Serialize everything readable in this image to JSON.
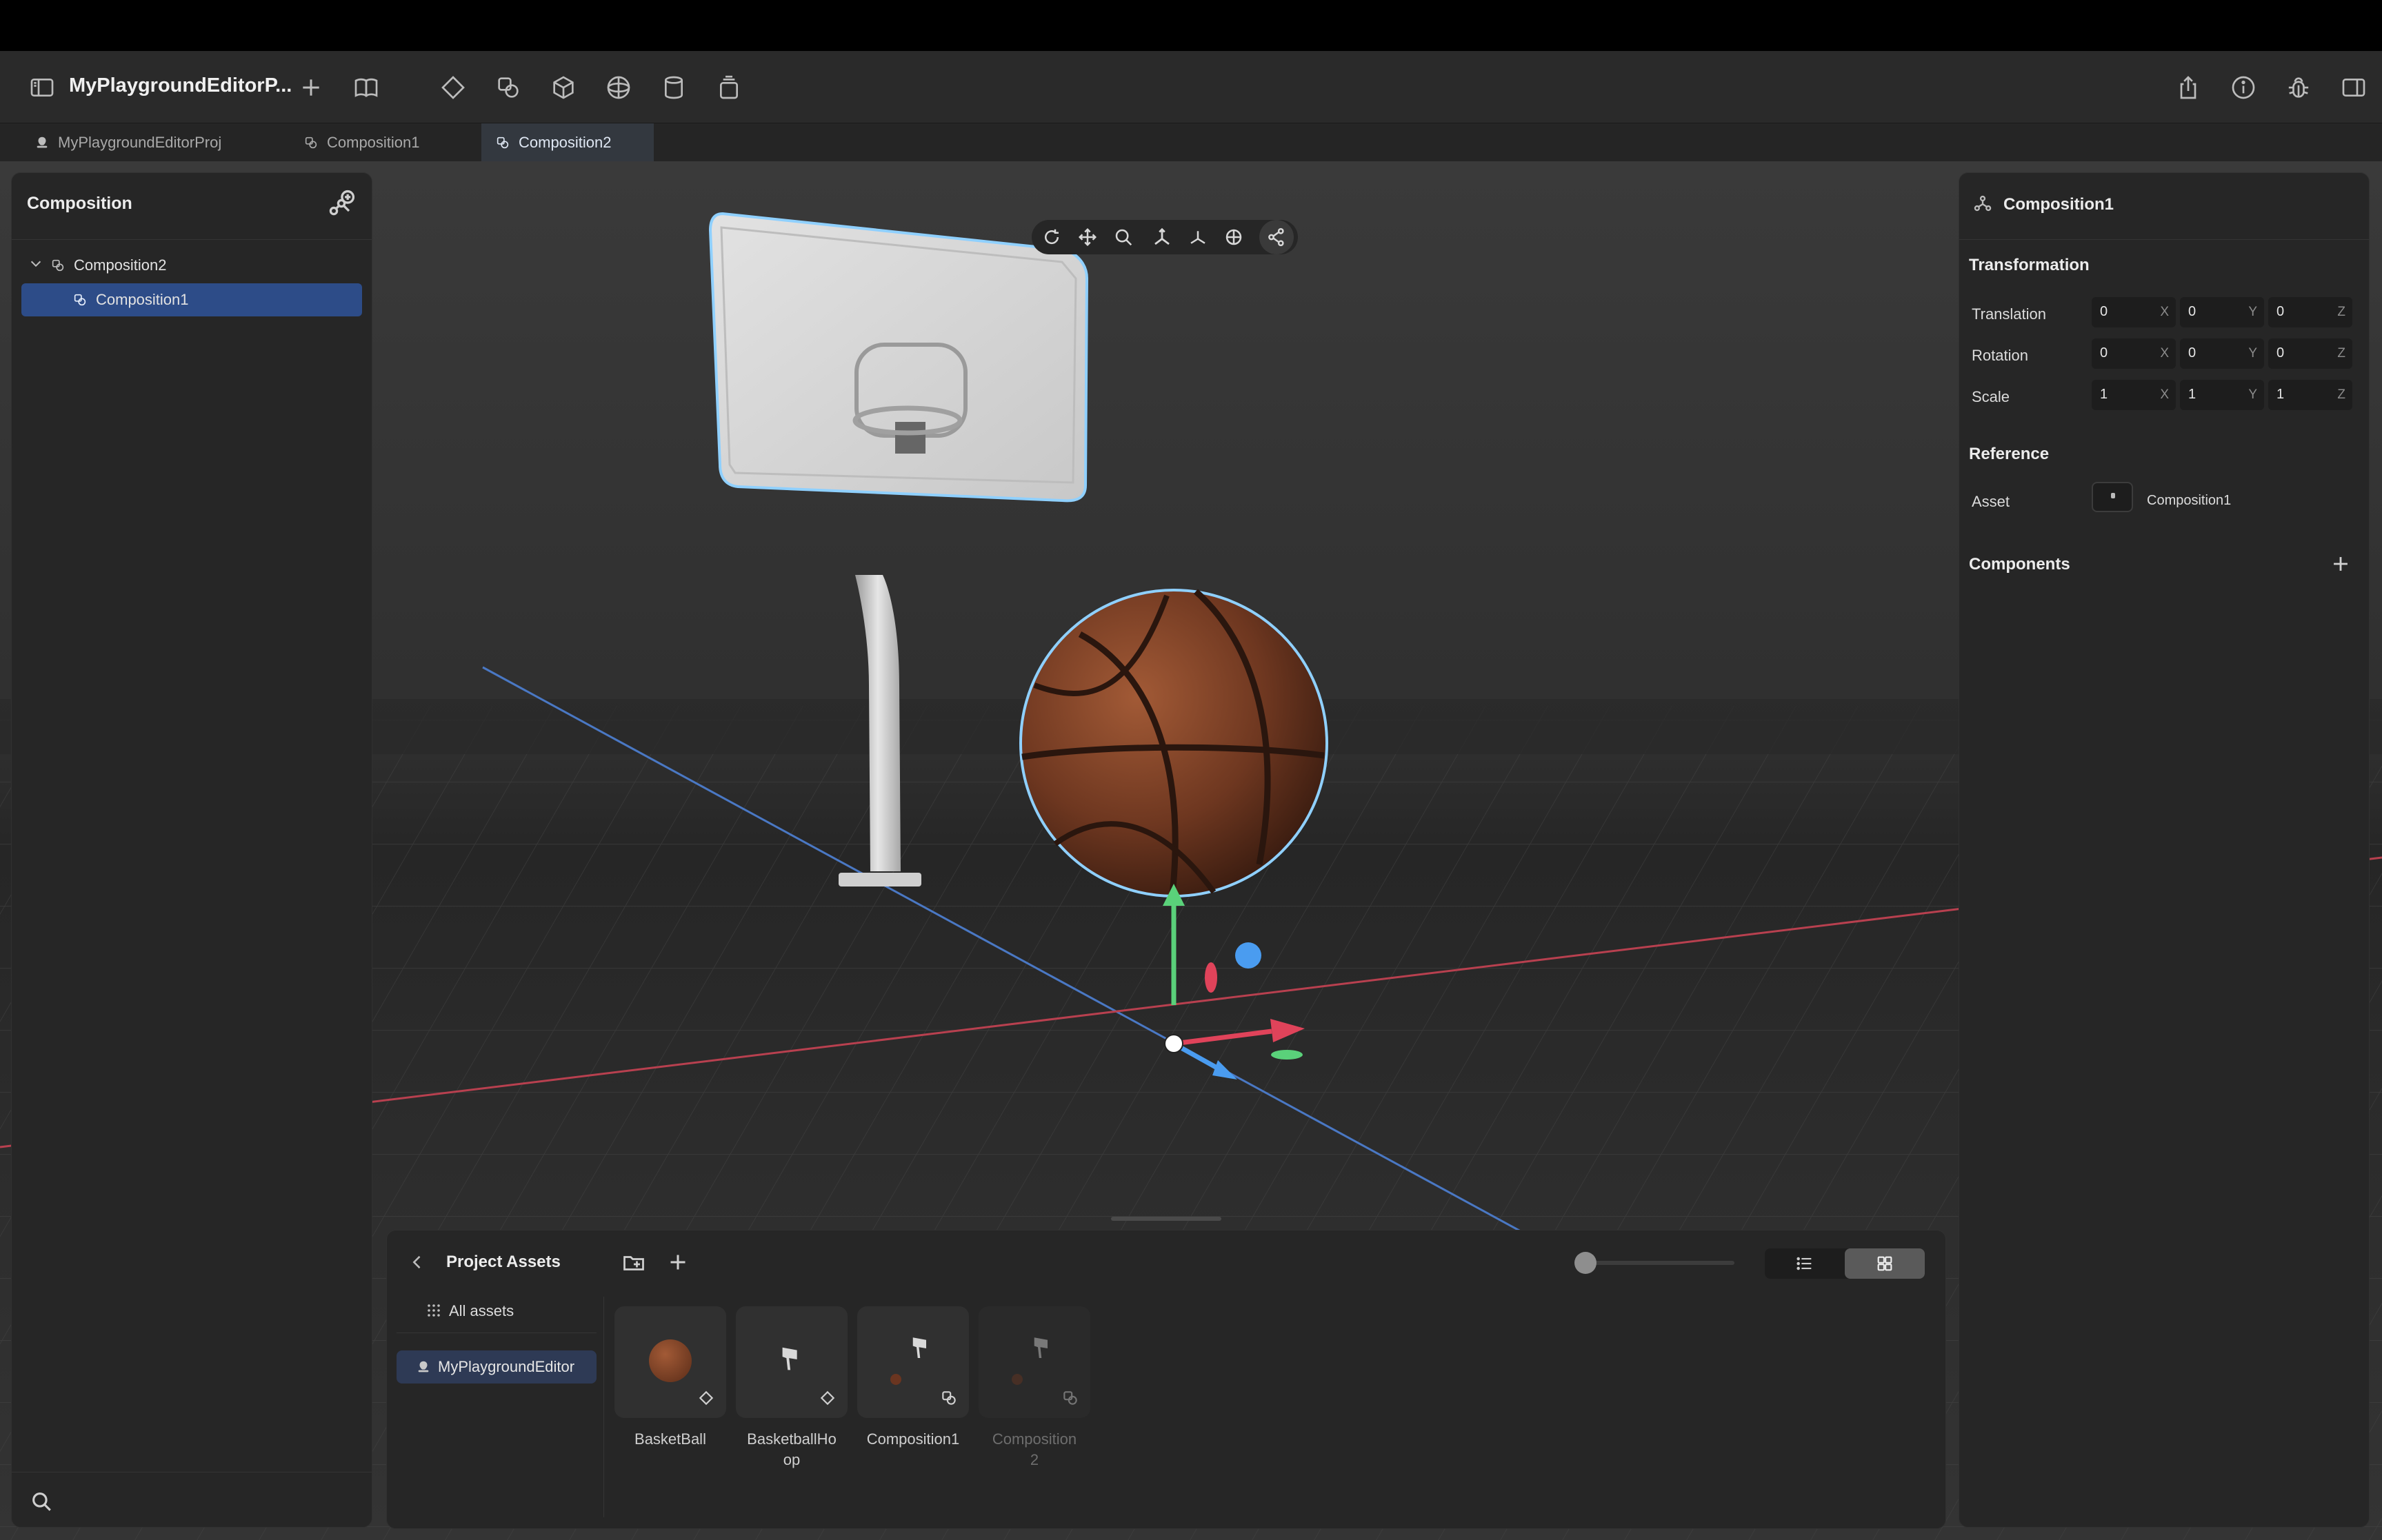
{
  "app": {
    "title": "MyPlaygroundEditorP..."
  },
  "tabs": [
    {
      "label": "MyPlaygroundEditorProj",
      "icon": "project-icon"
    },
    {
      "label": "Composition1",
      "icon": "composition-icon"
    },
    {
      "label": "Composition2",
      "icon": "composition-icon",
      "active": true
    }
  ],
  "left_panel": {
    "title": "Composition",
    "tree": [
      {
        "label": "Composition2",
        "expanded": true
      },
      {
        "label": "Composition1",
        "selected": true
      }
    ]
  },
  "inspector": {
    "header": "Composition1",
    "transformation": {
      "title": "Transformation",
      "rows": [
        {
          "label": "Translation",
          "x": "0",
          "y": "0",
          "z": "0"
        },
        {
          "label": "Rotation",
          "x": "0",
          "y": "0",
          "z": "0"
        },
        {
          "label": "Scale",
          "x": "1",
          "y": "1",
          "z": "1"
        }
      ],
      "axis": {
        "x": "X",
        "y": "Y",
        "z": "Z"
      }
    },
    "reference": {
      "title": "Reference",
      "asset_label": "Asset",
      "asset_value": "Composition1"
    },
    "components": {
      "title": "Components"
    }
  },
  "assets": {
    "title": "Project Assets",
    "all_assets": "All assets",
    "project_item": "MyPlaygroundEditor",
    "items": [
      {
        "name": "BasketBall",
        "name_lines": [
          "BasketBall",
          ""
        ]
      },
      {
        "name": "BasketballHoop",
        "name_lines": [
          "BasketballHo",
          "op"
        ]
      },
      {
        "name": "Composition1",
        "name_lines": [
          "Composition1",
          ""
        ]
      },
      {
        "name": "Composition2",
        "name_lines": [
          "Composition",
          "2"
        ]
      }
    ],
    "zoom_slider": 0.0,
    "view_mode": "grid"
  },
  "colors": {
    "selection": "#2d4c88",
    "x_axis": "#e0435a",
    "y_axis": "#5ad17a",
    "z_axis": "#4a9cf0",
    "outline": "#8fd0ff"
  }
}
